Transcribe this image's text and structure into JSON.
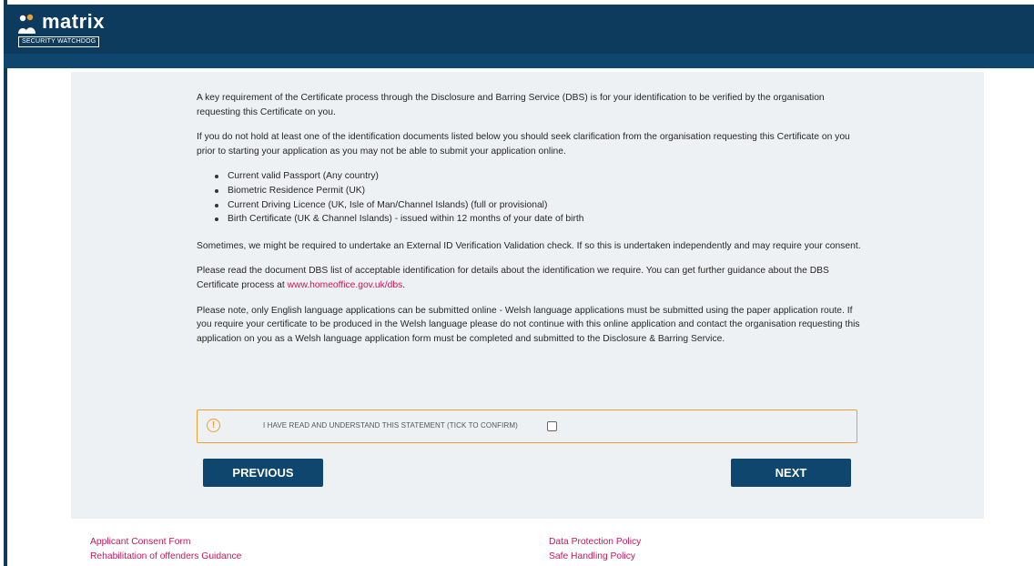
{
  "brand": {
    "name": "matrix",
    "tagline": "SECURITY WATCHDOG"
  },
  "content": {
    "para1": "A key requirement of the Certificate process through the Disclosure and Barring Service (DBS) is for your identification to be verified by the organisation requesting this Certificate on you.",
    "para2": "If you do not hold at least one of the identification documents listed below you should seek clarification from the organisation requesting this Certificate on you prior to starting your application as you may not be able to submit your application online.",
    "documents": [
      "Current valid Passport (Any country)",
      "Biometric Residence Permit (UK)",
      "Current Driving Licence (UK, Isle of Man/Channel Islands) (full or provisional)",
      "Birth Certificate (UK & Channel Islands) - issued within 12 months of your date of birth"
    ],
    "para3": "Sometimes, we might be required to undertake an External ID Verification Validation check. If so this is undertaken independently and may require your consent.",
    "para4_prefix": "Please read the document DBS list of acceptable identification for details about the identification we require. You can get further guidance about the DBS Certificate process at ",
    "para4_link": "www.homeoffice.gov.uk/dbs",
    "para4_suffix": ".",
    "para5": "Please note, only English language applications can be submitted online - Welsh language applications must be submitted using the paper application route. If you require your certificate to be produced in the Welsh language please do not continue with this online application and contact the organisation requesting this application on you as a Welsh language application form must be completed and submitted to the Disclosure & Barring Service."
  },
  "confirm": {
    "icon": "info-icon",
    "label": "I HAVE READ AND UNDERSTAND THIS STATEMENT (TICK TO CONFIRM)",
    "checked": false
  },
  "buttons": {
    "previous": "PREVIOUS",
    "next": "NEXT"
  },
  "footer": {
    "left": [
      "Applicant Consent Form",
      "Rehabilitation of offenders Guidance"
    ],
    "right": [
      "Data Protection Policy",
      "Safe Handling Policy"
    ]
  },
  "colors": {
    "header": "#0c3b5e",
    "button": "#0f466d",
    "link": "#c2185b",
    "warning": "#f0a030"
  }
}
